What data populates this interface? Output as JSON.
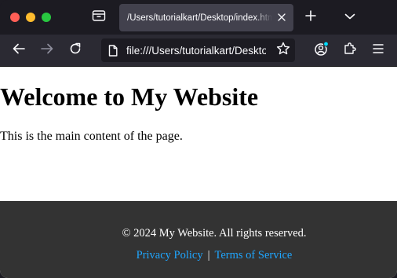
{
  "browser": {
    "tab": {
      "title": "/Users/tutorialkart/Desktop/index.html"
    },
    "urlbar": {
      "url": "file:///Users/tutorialkart/Desktop/index.html"
    }
  },
  "page": {
    "heading": "Welcome to My Website",
    "paragraph": "This is the main content of the page.",
    "footer": {
      "copyright": "© 2024 My Website. All rights reserved.",
      "links": [
        {
          "label": "Privacy Policy"
        },
        {
          "label": "Terms of Service"
        }
      ],
      "separator": "|"
    }
  },
  "colors": {
    "link": "#1fa6ff",
    "footer_bg": "#333333",
    "chrome_bg": "#1c1b22",
    "toolbar_bg": "#2b2a33"
  }
}
